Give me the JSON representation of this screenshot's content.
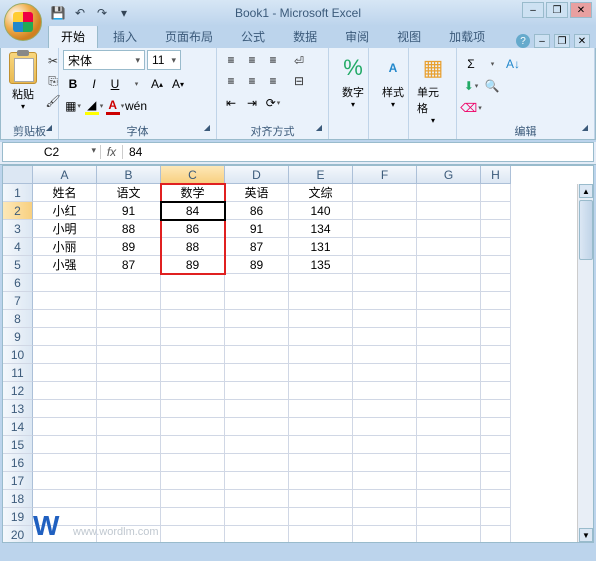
{
  "window": {
    "title": "Book1 - Microsoft Excel"
  },
  "qat": {
    "save": "💾",
    "undo": "↶",
    "redo": "↷",
    "more": "▾"
  },
  "tabs": [
    "开始",
    "插入",
    "页面布局",
    "公式",
    "数据",
    "审阅",
    "视图",
    "加载项"
  ],
  "active_tab": 0,
  "ribbon": {
    "clipboard": {
      "label": "剪贴板",
      "paste": "粘贴"
    },
    "font": {
      "label": "字体",
      "name": "宋体",
      "size": "11"
    },
    "alignment": {
      "label": "对齐方式"
    },
    "number": {
      "label": "数字"
    },
    "styles": {
      "label": "样式"
    },
    "cells": {
      "label": "单元格"
    },
    "editing": {
      "label": "编辑"
    }
  },
  "name_box": "C2",
  "formula": "84",
  "columns": [
    "A",
    "B",
    "C",
    "D",
    "E",
    "F",
    "G",
    "H"
  ],
  "row_count": 20,
  "active_cell": {
    "r": 2,
    "c": "C"
  },
  "selected_col": "C",
  "selected_row": 2,
  "highlight_box": {
    "col": "C",
    "r1": 1,
    "r2": 5
  },
  "cells": {
    "A1": "姓名",
    "B1": "语文",
    "C1": "数学",
    "D1": "英语",
    "E1": "文综",
    "A2": "小红",
    "B2": "91",
    "C2": "84",
    "D2": "86",
    "E2": "140",
    "A3": "小明",
    "B3": "88",
    "C3": "86",
    "D3": "91",
    "E3": "134",
    "A4": "小丽",
    "B4": "89",
    "C4": "88",
    "D4": "87",
    "E4": "131",
    "A5": "小强",
    "B5": "87",
    "C5": "89",
    "D5": "89",
    "E5": "135"
  },
  "watermark": "www.wordlm.com",
  "chart_data": {
    "type": "table",
    "columns": [
      "姓名",
      "语文",
      "数学",
      "英语",
      "文综"
    ],
    "rows": [
      [
        "小红",
        91,
        84,
        86,
        140
      ],
      [
        "小明",
        88,
        86,
        91,
        134
      ],
      [
        "小丽",
        89,
        88,
        87,
        131
      ],
      [
        "小强",
        87,
        89,
        89,
        135
      ]
    ]
  }
}
